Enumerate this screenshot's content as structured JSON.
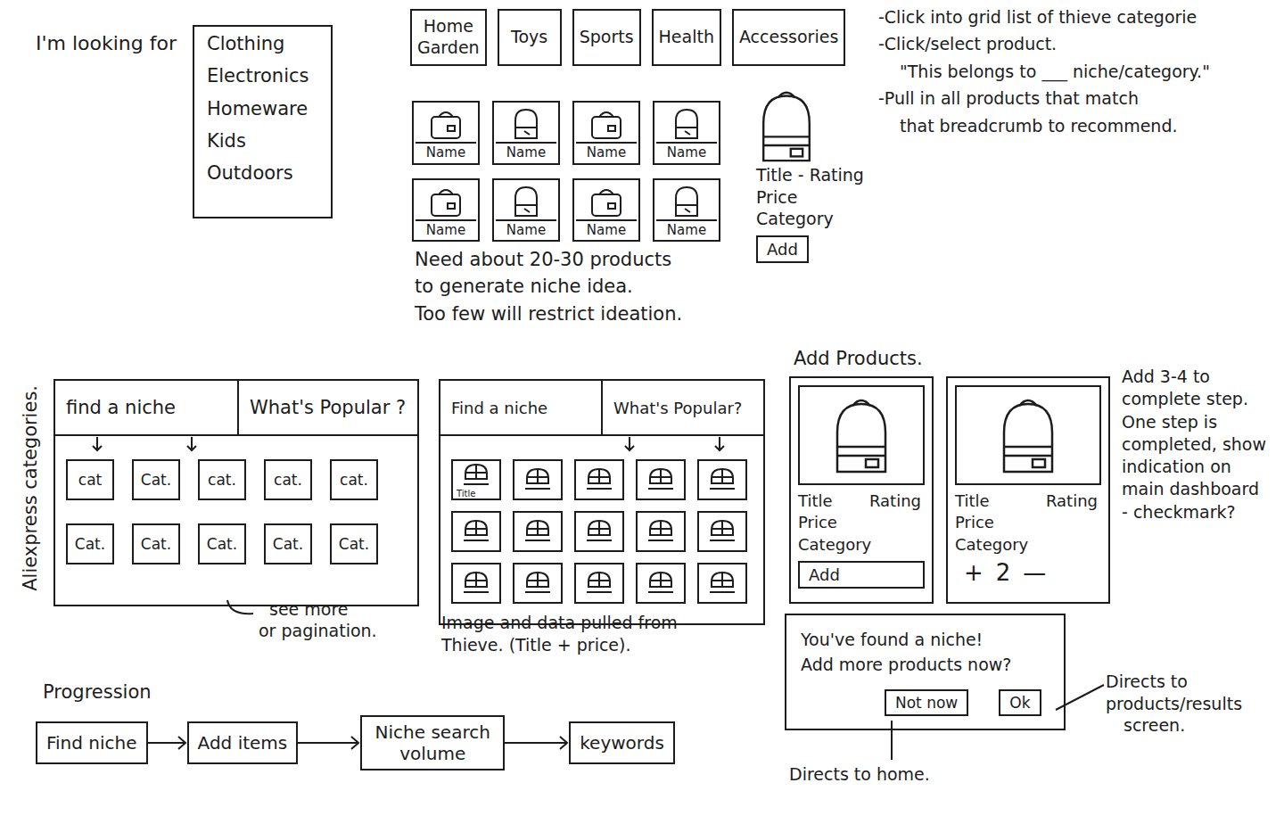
{
  "intro": {
    "label": "I'm looking for",
    "options": [
      "Clothing",
      "Electronics",
      "Homeware",
      "Kids",
      "Outdoors"
    ]
  },
  "categoryTabs": [
    "Home Garden",
    "Toys",
    "Sports",
    "Health",
    "Accessories"
  ],
  "productGrid": {
    "items": [
      "Name",
      "Name",
      "Name",
      "Name",
      "Name",
      "Name",
      "Name",
      "Name"
    ]
  },
  "gridNote": [
    "Need about 20-30 products",
    "to generate niche idea.",
    "Too few will restrict ideation."
  ],
  "productDetail": {
    "lines": [
      "Title - Rating",
      "Price",
      "Category"
    ],
    "button": "Add"
  },
  "notes": [
    {
      "lines": [
        "-Click into grid list of thieve categorie"
      ]
    },
    {
      "lines": [
        "-Click/select product.",
        "\"This belongs to ___ niche/category.\""
      ]
    },
    {
      "lines": [
        "-Pull in all products that match",
        "that breadcrumb to recommend."
      ]
    }
  ],
  "aliexpress": {
    "sideLabel": "Aliexpress categories.",
    "tabs": [
      "find a niche",
      "What's Popular ?"
    ],
    "cells": [
      "cat",
      "Cat.",
      "cat.",
      "cat.",
      "cat.",
      "Cat.",
      "Cat.",
      "Cat.",
      "Cat.",
      "Cat."
    ],
    "footnote": [
      "see more",
      "or pagination."
    ]
  },
  "popular": {
    "tabs": [
      "Find a niche",
      "What's Popular?"
    ],
    "thumbnails": [
      {
        "label": "Title"
      },
      {
        "label": ""
      },
      {
        "label": ""
      },
      {
        "label": ""
      },
      {
        "label": ""
      },
      {
        "label": ""
      },
      {
        "label": ""
      },
      {
        "label": ""
      },
      {
        "label": ""
      },
      {
        "label": ""
      },
      {
        "label": ""
      },
      {
        "label": ""
      },
      {
        "label": ""
      },
      {
        "label": ""
      },
      {
        "label": ""
      }
    ],
    "caption": [
      "Image and data pulled from",
      "Thieve. (Title + price)."
    ]
  },
  "addProducts": {
    "title": "Add Products.",
    "cards": [
      {
        "kind": "add",
        "title": "Title",
        "rating": "Rating",
        "price": "Price",
        "category": "Category",
        "button": "Add"
      },
      {
        "kind": "stepper",
        "title": "Title",
        "rating": "Rating",
        "price": "Price",
        "category": "Category",
        "plus": "+",
        "count": "2",
        "minus": "—"
      }
    ],
    "stepNote": [
      "Add 3-4 to",
      "complete step.",
      "One step is",
      "completed, show",
      "indication on",
      "main dashboard",
      "- checkmark?"
    ]
  },
  "dialog": {
    "message": [
      "You've found a niche!",
      "Add more products now?"
    ],
    "buttons": [
      "Not now",
      "Ok"
    ],
    "okNote": [
      "Directs to",
      "products/results",
      "screen."
    ],
    "notNowNote": "Directs to home."
  },
  "progression": {
    "title": "Progression",
    "steps": [
      "Find niche",
      "Add items",
      "Niche search volume",
      "keywords"
    ]
  }
}
